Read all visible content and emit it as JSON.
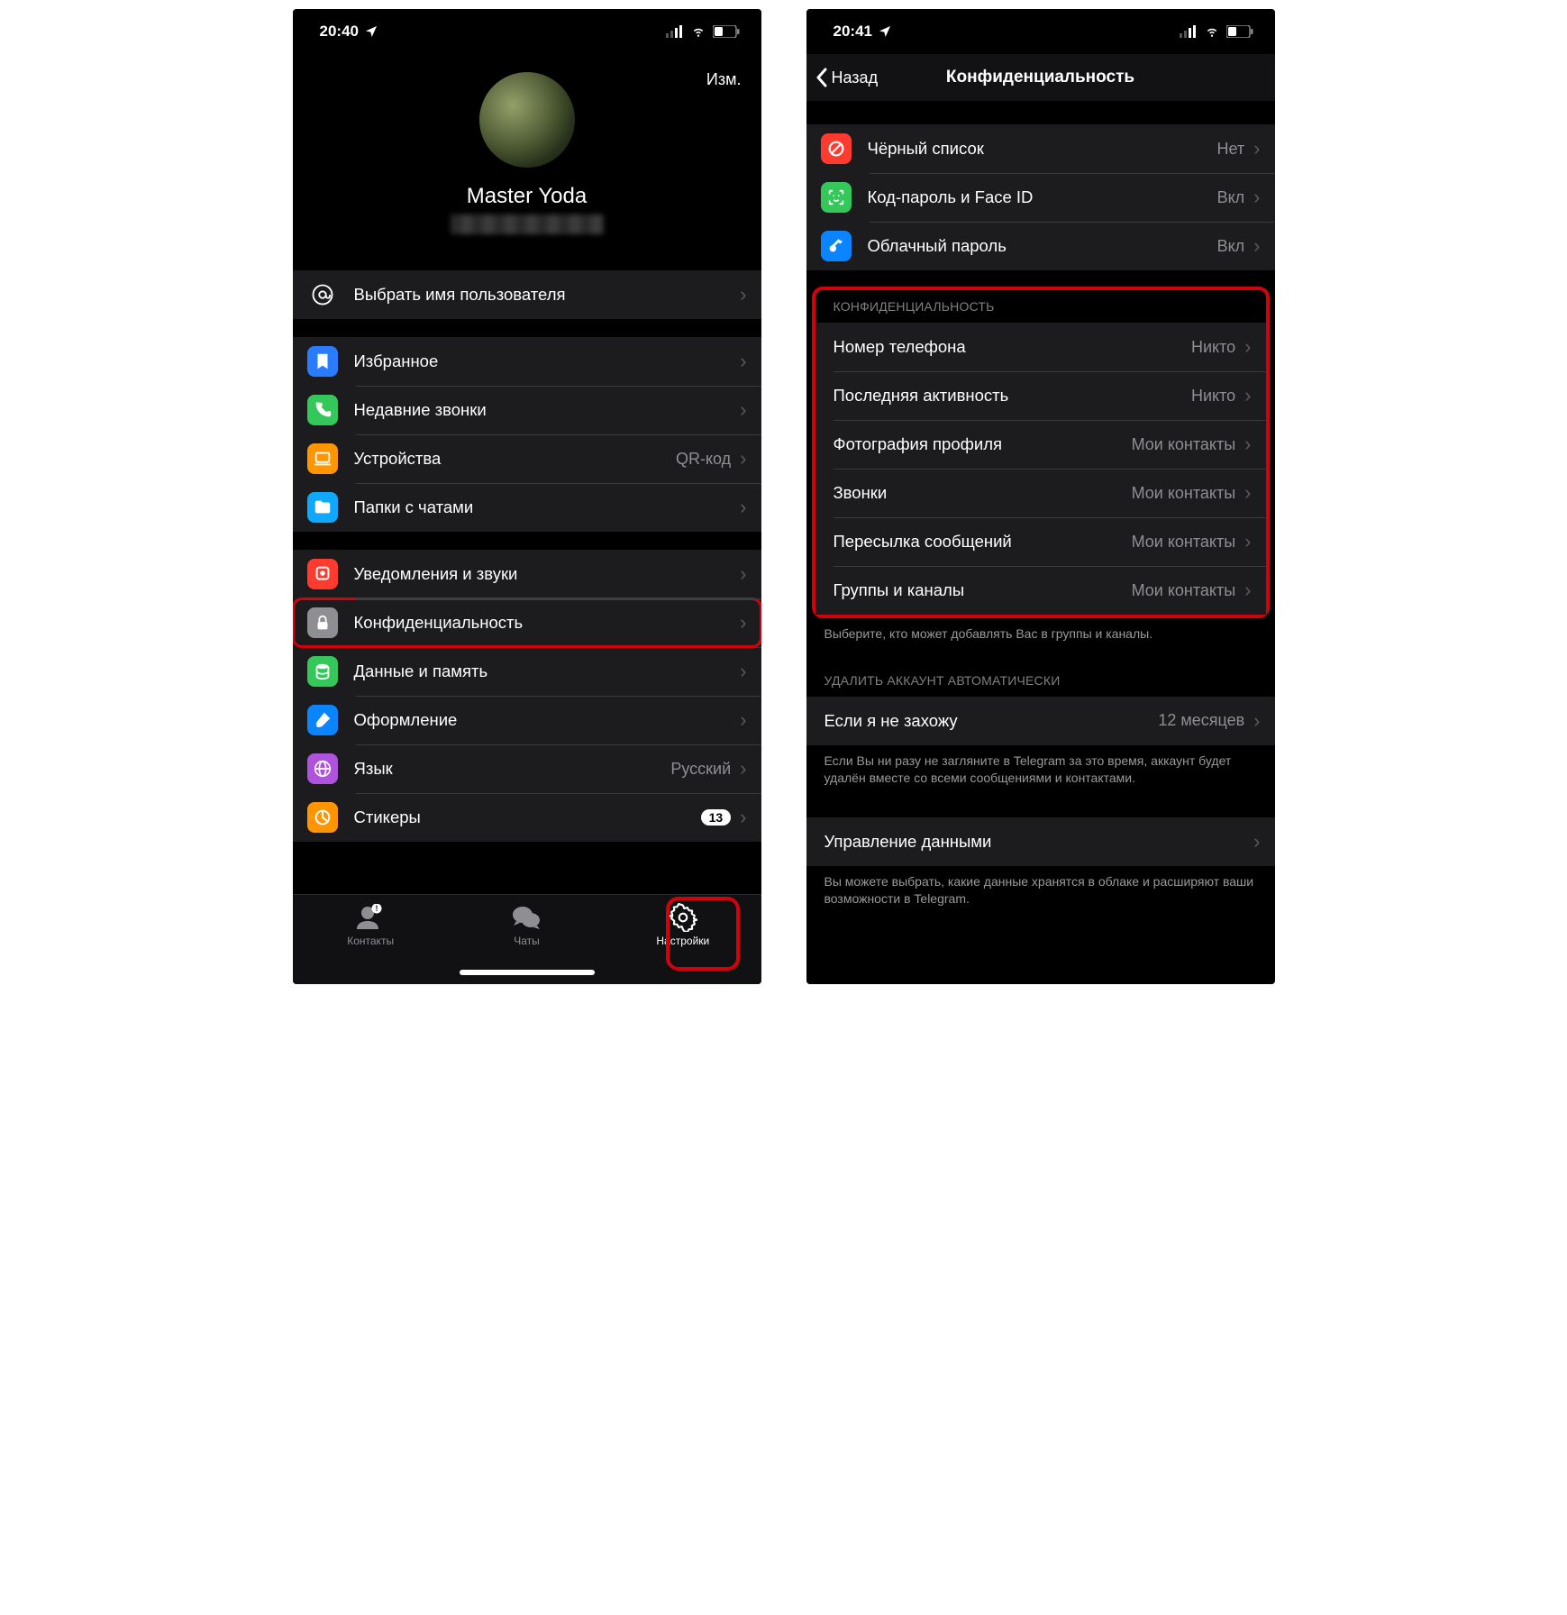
{
  "left": {
    "status_time": "20:40",
    "edit": "Изм.",
    "profile_name": "Master Yoda",
    "username_row": {
      "label": "Выбрать имя пользователя"
    },
    "group1": [
      {
        "id": "saved",
        "label": "Избранное",
        "icon": "bookmark-icon",
        "color": "#2a7cff"
      },
      {
        "id": "recent-calls",
        "label": "Недавние звонки",
        "icon": "phone-icon",
        "color": "#34c759"
      },
      {
        "id": "devices",
        "label": "Устройства",
        "icon": "laptop-icon",
        "color": "#ff9500",
        "value": "QR-код"
      },
      {
        "id": "chat-folders",
        "label": "Папки с чатами",
        "icon": "folder-icon",
        "color": "#0fa8ff"
      }
    ],
    "group2": [
      {
        "id": "notifications",
        "label": "Уведомления и звуки",
        "icon": "bell-icon",
        "color": "#ff3b30"
      },
      {
        "id": "privacy",
        "label": "Конфиденциальность",
        "icon": "lock-icon",
        "color": "#8e8e93",
        "highlight": true
      },
      {
        "id": "data",
        "label": "Данные и память",
        "icon": "disks-icon",
        "color": "#34c759"
      },
      {
        "id": "appearance",
        "label": "Оформление",
        "icon": "brush-icon",
        "color": "#0a84ff"
      },
      {
        "id": "language",
        "label": "Язык",
        "icon": "globe-icon",
        "color": "#af52de",
        "value": "Русский"
      },
      {
        "id": "stickers",
        "label": "Стикеры",
        "icon": "pie-icon",
        "color": "#ff9500",
        "badge": "13"
      }
    ],
    "tabs": {
      "contacts": "Контакты",
      "chats": "Чаты",
      "settings": "Настройки"
    }
  },
  "right": {
    "status_time": "20:41",
    "back": "Назад",
    "title": "Конфиденциальность",
    "security": [
      {
        "id": "blocked",
        "label": "Чёрный список",
        "icon": "block-icon",
        "color": "#ff3b30",
        "value": "Нет"
      },
      {
        "id": "passcode",
        "label": "Код-пароль и Face ID",
        "icon": "faceid-icon",
        "color": "#34c759",
        "value": "Вкл"
      },
      {
        "id": "cloud-password",
        "label": "Облачный пароль",
        "icon": "key-icon",
        "color": "#0a84ff",
        "value": "Вкл"
      }
    ],
    "privacy_header": "КОНФИДЕНЦИАЛЬНОСТЬ",
    "privacy": [
      {
        "id": "phone",
        "label": "Номер телефона",
        "value": "Никто"
      },
      {
        "id": "lastseen",
        "label": "Последняя активность",
        "value": "Никто"
      },
      {
        "id": "photo",
        "label": "Фотография профиля",
        "value": "Мои контакты"
      },
      {
        "id": "calls",
        "label": "Звонки",
        "value": "Мои контакты"
      },
      {
        "id": "forwarding",
        "label": "Пересылка сообщений",
        "value": "Мои контакты"
      },
      {
        "id": "groups",
        "label": "Группы и каналы",
        "value": "Мои контакты"
      }
    ],
    "privacy_footer": "Выберите, кто может добавлять Вас в группы и каналы.",
    "delete_header": "УДАЛИТЬ АККАУНТ АВТОМАТИЧЕСКИ",
    "delete_row": {
      "label": "Если я не захожу",
      "value": "12 месяцев"
    },
    "delete_footer": "Если Вы ни разу не загляните в Telegram за это время, аккаунт будет удалён вместе со всеми сообщениями и контактами.",
    "data_row": {
      "label": "Управление данными"
    },
    "data_footer": "Вы можете выбрать, какие данные хранятся в облаке и расширяют ваши возможности в Telegram."
  }
}
